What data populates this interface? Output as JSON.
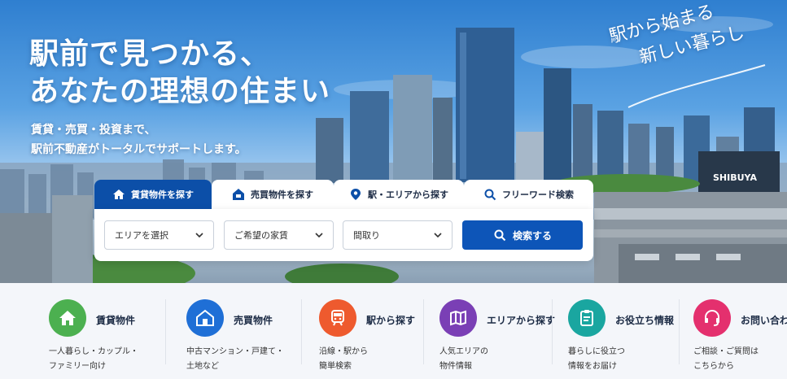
{
  "hero": {
    "headline_line1": "駅前で見つかる、",
    "headline_line2": "あなたの理想の住まい",
    "sub_line1": "賃貸・売買・投資まで、",
    "sub_line2": "駅前不動産がトータルでサポートします。",
    "script_line1": "駅から始まる",
    "script_line2": "新しい暮らし",
    "building_sign": "SHIBUYA"
  },
  "search": {
    "tabs": [
      {
        "label": "賃貸物件を探す",
        "icon": "home-icon",
        "active": true
      },
      {
        "label": "売買物件を探す",
        "icon": "house-icon",
        "active": false
      },
      {
        "label": "駅・エリアから探す",
        "icon": "map-pin-icon",
        "active": false
      },
      {
        "label": "フリーワード検索",
        "icon": "search-icon",
        "active": false
      }
    ],
    "area_select": "エリアを選択",
    "rent_select": "ご希望の家賃",
    "layout_select": "間取り",
    "search_button": "検索する"
  },
  "categories": [
    {
      "title": "賃貸物件",
      "desc1": "一人暮らし・カップル・",
      "desc2": "ファミリー向け",
      "color": "#4cb050",
      "icon": "home-icon"
    },
    {
      "title": "売買物件",
      "desc1": "中古マンション・戸建て・",
      "desc2": "土地など",
      "color": "#1f6fd6",
      "icon": "house-icon"
    },
    {
      "title": "駅から探す",
      "desc1": "沿線・駅から",
      "desc2": "簡単検索",
      "color": "#ee5a2e",
      "icon": "train-icon"
    },
    {
      "title": "エリアから探す",
      "desc1": "人気エリアの",
      "desc2": "物件情報",
      "color": "#7a3fb5",
      "icon": "map-icon"
    },
    {
      "title": "お役立ち情報",
      "desc1": "暮らしに役立つ",
      "desc2": "情報をお届け",
      "color": "#1aa6a0",
      "icon": "clipboard-icon"
    },
    {
      "title": "お問い合わ",
      "desc1": "ご相談・ご質問は",
      "desc2": "こちらから",
      "color": "#e4306e",
      "icon": "headset-icon"
    }
  ],
  "colors": {
    "primary": "#0c4fa8",
    "button": "#0d55b8"
  }
}
